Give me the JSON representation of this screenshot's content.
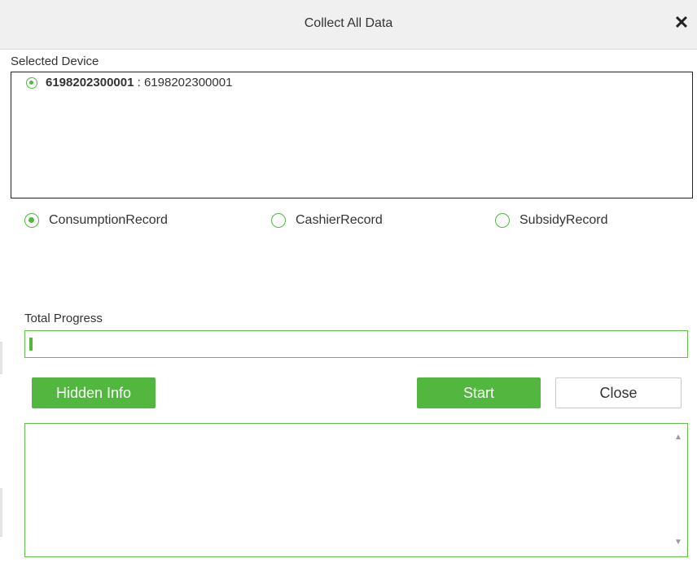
{
  "dialog": {
    "title": "Collect All Data",
    "close_icon": "✕"
  },
  "device_section": {
    "label": "Selected Device",
    "items": [
      {
        "id": "6198202300001",
        "separator": ":",
        "name": "6198202300001",
        "selected": true
      }
    ]
  },
  "record_options": [
    {
      "label": "ConsumptionRecord",
      "selected": true
    },
    {
      "label": "CashierRecord",
      "selected": false
    },
    {
      "label": "SubsidyRecord",
      "selected": false
    }
  ],
  "progress": {
    "label": "Total Progress",
    "value_percent": 0.5
  },
  "buttons": {
    "hidden_info": "Hidden Info",
    "start": "Start",
    "close": "Close"
  },
  "colors": {
    "accent": "#52b73e",
    "titlebar": "#f0f0f0"
  },
  "icons": {
    "close": "close-icon",
    "scroll_up": "scroll-up-arrow-icon",
    "scroll_down": "scroll-down-arrow-icon"
  }
}
